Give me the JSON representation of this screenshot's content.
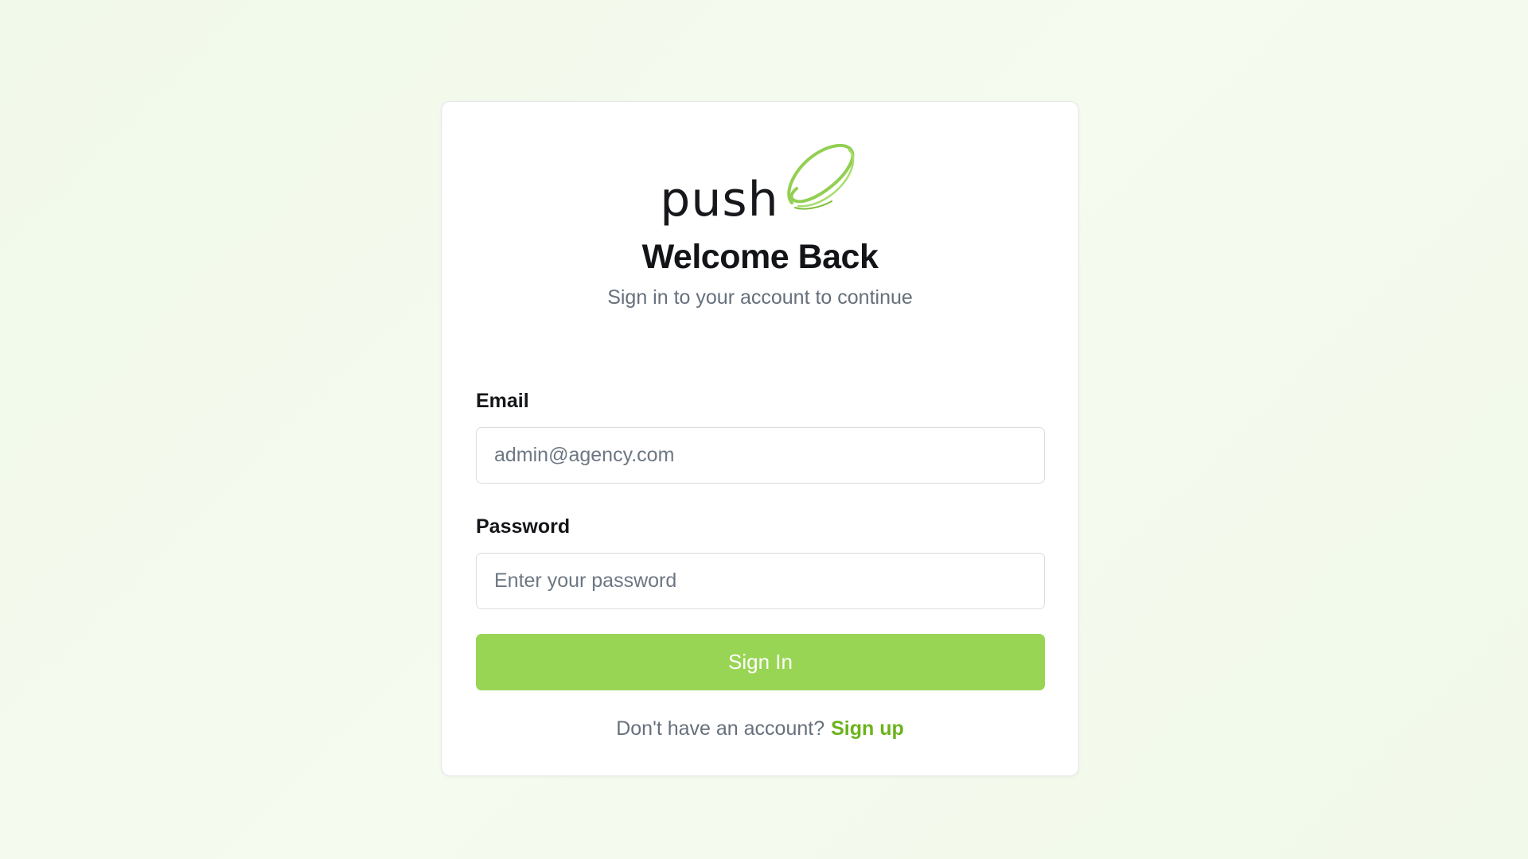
{
  "app": {
    "logo_text": "push",
    "logo_mark_icon": "green-swoosh-logo-icon",
    "accent_color": "#99d554",
    "link_color": "#6bb31c"
  },
  "login": {
    "title": "Welcome Back",
    "subtitle": "Sign in to your account to continue",
    "email": {
      "label": "Email",
      "placeholder": "admin@agency.com",
      "value": ""
    },
    "password": {
      "label": "Password",
      "placeholder": "Enter your password",
      "value": ""
    },
    "submit_label": "Sign In",
    "signup_prompt": "Don't have an account?",
    "signup_link": "Sign up"
  }
}
